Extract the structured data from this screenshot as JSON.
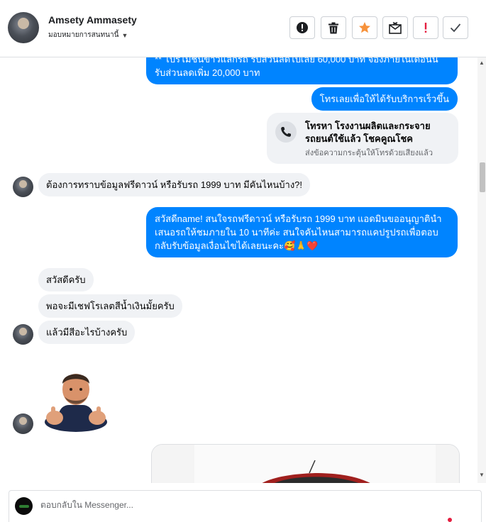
{
  "header": {
    "user_name": "Amsety Ammasety",
    "user_subtitle": "มอบหมายการสนทนานี้"
  },
  "messages": {
    "out_1": "** โปรโมชั่นข่าวแลกรถ รับส่วนลดไปเลย 60,000 บาท จองภายในเดือนนี้ รับส่วนลดเพิ่ม 20,000 บาท",
    "out_2": "โทรเลยเพื่อให้ได้รับบริการเร็วขึ้น",
    "call_title": "โทรหา โรงงานผลิตและกระจายรถยนต์ใช้แล้ว โชคคูณโชค",
    "call_sub": "ส่งข้อความกระตุ้นให้โทรด้วยเสียงแล้ว",
    "in_1": "ต้องการทราบข้อมูลฟรีดาวน์ หรือรับรถ 1999 บาท มีคันไหนบ้าง?!",
    "out_3": "สวัสดีname! สนใจรถฟรีดาวน์ หรือรับรถ 1999 บาท แอดมินขออนุญาตินำเสนอรถให้ชมภายใน 10 นาทีค่ะ สนใจคันไหนสามารถแคปรูปรถเพื่อตอบกลับรับข้อมูลเงื่อนไขได้เลยนะคะ🥰🙏❤️",
    "in_2": "สวัสดีครับ",
    "in_3": "พอจะมีเชฟโรเลตสีน้ำเงินมั้ยครับ",
    "in_4": "แล้วมีสีอะไรบ้างครับ"
  },
  "composer": {
    "placeholder": "ตอบกลับใน Messenger..."
  },
  "icons": {
    "header_actions": [
      "alert-circle-icon",
      "trash-icon",
      "star-icon",
      "mail-x-icon",
      "exclamation-icon",
      "check-icon"
    ],
    "call": "phone-icon"
  },
  "colors": {
    "outgoing_bubble": "#0084ff",
    "incoming_bubble": "#f0f2f5",
    "star": "#f7923b",
    "alert": "#e41e3f"
  }
}
